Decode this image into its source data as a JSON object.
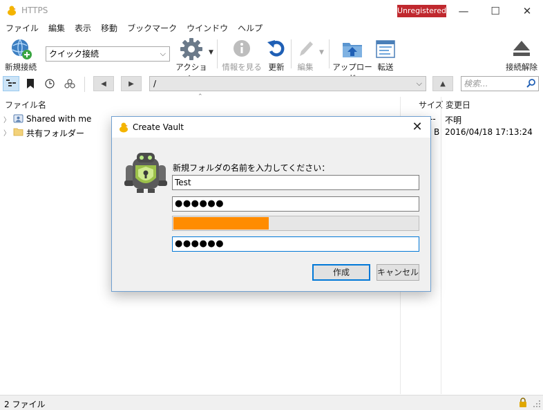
{
  "window": {
    "title": "HTTPS",
    "badge": "Unregistered",
    "controls": {
      "minimize": "—",
      "maximize": "☐",
      "close": "✕"
    }
  },
  "menu": [
    "ファイル",
    "編集",
    "表示",
    "移動",
    "ブックマーク",
    "ウインドウ",
    "ヘルプ"
  ],
  "toolbar": {
    "new_connection": "新規接続",
    "quick_connect": "クイック接続",
    "action": "アクション",
    "info": "情報を見る",
    "refresh": "更新",
    "edit": "編集",
    "upload": "アップロード",
    "transfer": "転送",
    "disconnect": "接続解除"
  },
  "pathbar": {
    "path": "/",
    "search_placeholder": "検索..."
  },
  "filelist": {
    "columns": {
      "name": "ファイル名",
      "size": "サイズ",
      "modified": "変更日"
    },
    "rows": [
      {
        "name": "Shared with me",
        "size": "--",
        "modified": "不明"
      },
      {
        "name": "共有フォルダー",
        "size": "B",
        "modified": "2016/04/18 17:13:24"
      }
    ]
  },
  "status": {
    "text": "2 ファイル"
  },
  "dialog": {
    "title": "Create Vault",
    "prompt": "新規フォルダの名前を入力してください：",
    "name_value": "Test",
    "password_mask": "●●●●●●",
    "confirm_mask": "●●●●●●",
    "strength": 0.39,
    "strength_color": "#ff8c00",
    "ok_label": "作成",
    "cancel_label": "キャンセル"
  },
  "colors": {
    "badge": "#c0282e",
    "accent": "#0078d7"
  }
}
